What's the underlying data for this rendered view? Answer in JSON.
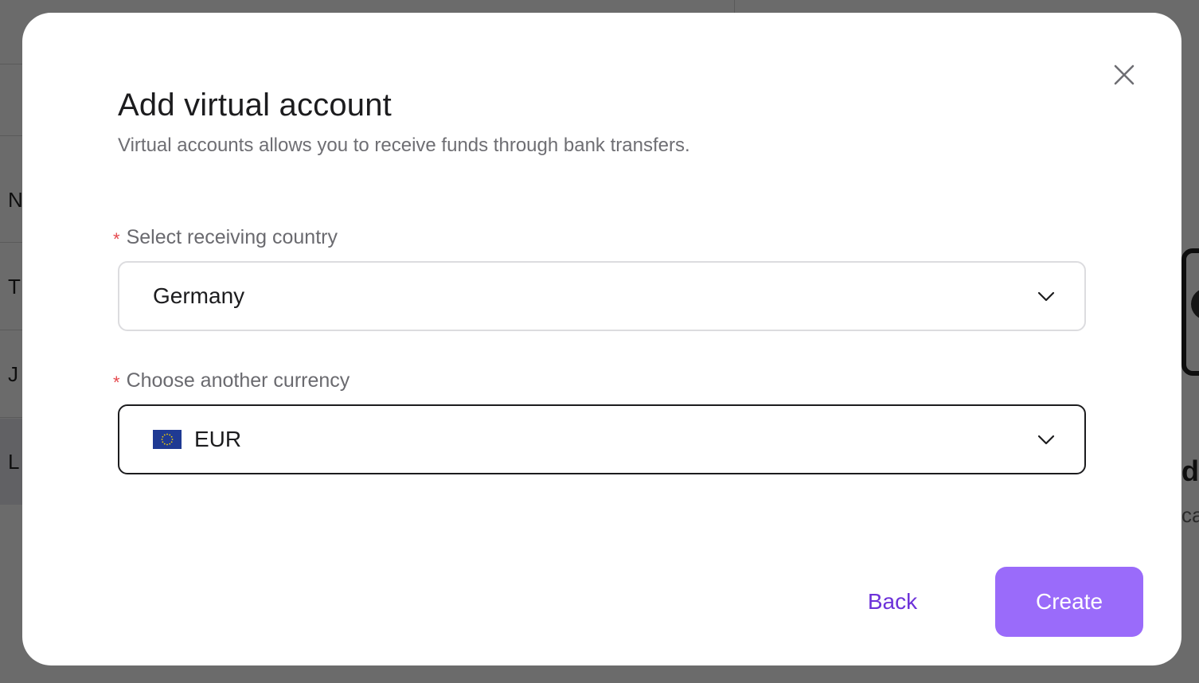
{
  "background_page": {
    "row_letters": [
      "N",
      "T",
      "J",
      "L"
    ],
    "right_heading_fragment": "d",
    "right_text_fragment": "ca"
  },
  "modal": {
    "title": "Add virtual account",
    "subtitle": "Virtual accounts allows you to receive funds through bank transfers.",
    "close_icon": "close-icon",
    "fields": {
      "country": {
        "required_mark": "*",
        "label": "Select receiving country",
        "value": "Germany",
        "icon": "chevron-down-icon"
      },
      "currency": {
        "required_mark": "*",
        "label": "Choose another currency",
        "value": "EUR",
        "flag": "eu-flag-icon",
        "icon": "chevron-down-icon"
      }
    },
    "actions": {
      "back_label": "Back",
      "create_label": "Create"
    }
  },
  "colors": {
    "accent": "#9a6bfa",
    "link": "#6d32d9",
    "required": "#e5484d",
    "focused_border": "#1c1c1e"
  }
}
